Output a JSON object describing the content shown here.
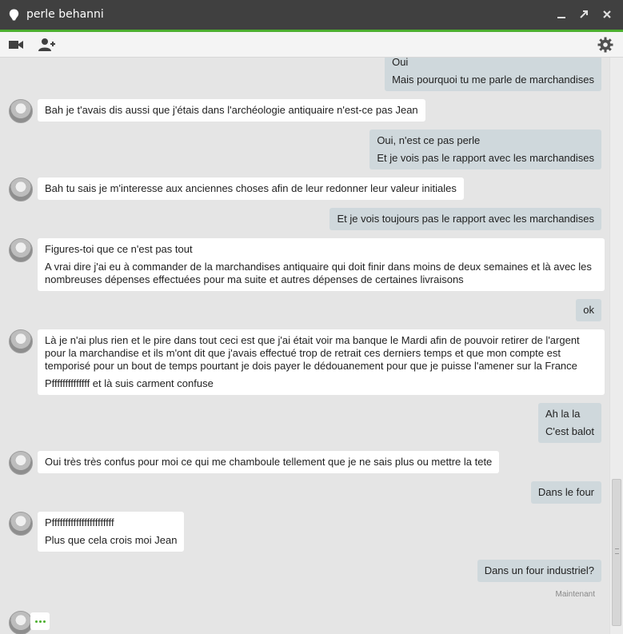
{
  "window": {
    "contact_name": "perle behanni",
    "status_color": "#ffffff",
    "accent_color": "#4caf2f",
    "icons": [
      "minimize-icon",
      "popout-icon",
      "close-icon"
    ]
  },
  "toolbar": {
    "icons": [
      "video-call-icon",
      "add-person-icon",
      "settings-gear-icon"
    ]
  },
  "messages": [
    {
      "from": "me",
      "lines": [
        "Oui",
        "Mais pourquoi tu me parle de marchandises"
      ]
    },
    {
      "from": "contact",
      "lines": [
        "Bah je t'avais dis aussi que j'étais dans l'archéologie antiquaire n'est-ce pas Jean"
      ]
    },
    {
      "from": "me",
      "lines": [
        "Oui, n'est ce pas perle",
        "Et je vois pas le rapport avec les marchandises"
      ]
    },
    {
      "from": "contact",
      "lines": [
        "Bah tu sais je m'interesse aux anciennes choses afin de leur redonner leur valeur initiales"
      ]
    },
    {
      "from": "me",
      "lines": [
        "Et je vois toujours pas le rapport avec les marchandises"
      ]
    },
    {
      "from": "contact",
      "lines": [
        "Figures-toi que ce n'est pas tout",
        "A vrai dire j'ai eu à  commander de la marchandises antiquaire qui doit finir dans moins de deux semaines et là avec les nombreuses dépenses effectuées pour ma suite et autres dépenses de certaines livraisons"
      ]
    },
    {
      "from": "me",
      "lines": [
        "ok"
      ]
    },
    {
      "from": "contact",
      "lines": [
        "Là je n'ai plus rien et le pire dans tout ceci est que j'ai était voir ma banque le Mardi afin de pouvoir retirer de l'argent pour la marchandise et ils m'ont dit que j'avais effectué trop de retrait ces derniers temps et que mon compte est temporisé pour un bout de temps pourtant je dois payer le dédouanement pour que je puisse l'amener sur la  France",
        "Pffffffffffffff  et là suis carment confuse"
      ]
    },
    {
      "from": "me",
      "lines": [
        "Ah la la",
        "C'est balot"
      ]
    },
    {
      "from": "contact",
      "lines": [
        "Oui très très confus pour moi ce qui me chamboule tellement que je ne sais plus ou mettre la tete"
      ]
    },
    {
      "from": "me",
      "lines": [
        "Dans le four"
      ]
    },
    {
      "from": "contact",
      "lines": [
        "Pfffffffffffffffffffffff",
        "Plus que cela crois moi Jean"
      ]
    },
    {
      "from": "me",
      "lines": [
        "Dans un four industriel?"
      ]
    }
  ],
  "last_timestamp": "Maintenant",
  "typing_indicator": "..."
}
